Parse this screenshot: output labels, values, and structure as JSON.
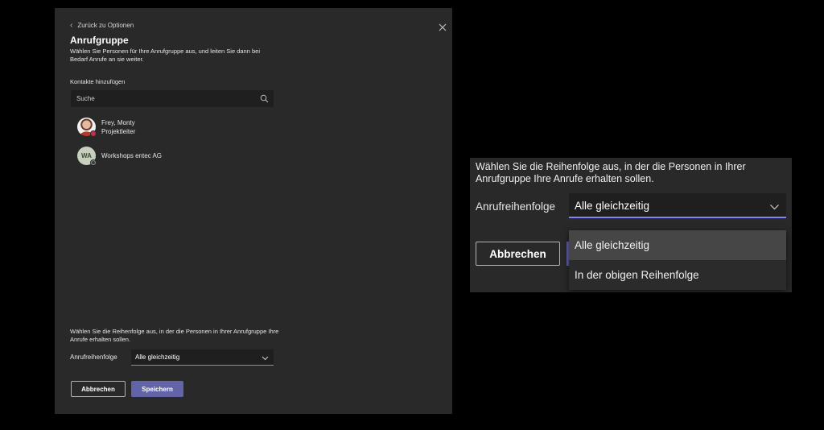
{
  "dialog": {
    "back_label": "Zurück zu Optionen",
    "title": "Anrufgruppe",
    "subtitle": "Wählen Sie Personen für Ihre Anrufgruppe aus, und leiten Sie dann bei Bedarf Anrufe an sie weiter.",
    "contacts_label": "Kontakte hinzufügen",
    "search_placeholder": "Suche",
    "contacts": [
      {
        "name": "Frey, Monty",
        "role": "Projektleiter",
        "avatar": "photo",
        "presence": "busy"
      },
      {
        "name": "Workshops entec AG",
        "initials": "WA",
        "presence": "offline"
      }
    ],
    "order_description": "Wählen Sie die Reihenfolge aus, in der die Personen in Ihrer Anrufgruppe Ihre Anrufe erhalten sollen.",
    "order_label": "Anrufreihenfolge",
    "order_value": "Alle gleichzeitig",
    "cancel_label": "Abbrechen",
    "save_label": "Speichern"
  },
  "zoom": {
    "order_description": "Wählen Sie die Reihenfolge aus, in der die Personen in Ihrer Anrufgruppe Ihre Anrufe erhalten sollen.",
    "order_label": "Anrufreihenfolge",
    "order_value": "Alle gleichzeitig",
    "cancel_label": "Abbrechen",
    "options": [
      "Alle gleichzeitig",
      "In der obigen Reihenfolge"
    ]
  },
  "colors": {
    "accent": "#6264a7",
    "focus_underline": "#7f85f5",
    "busy": "#c4314b",
    "panel": "#292929"
  }
}
